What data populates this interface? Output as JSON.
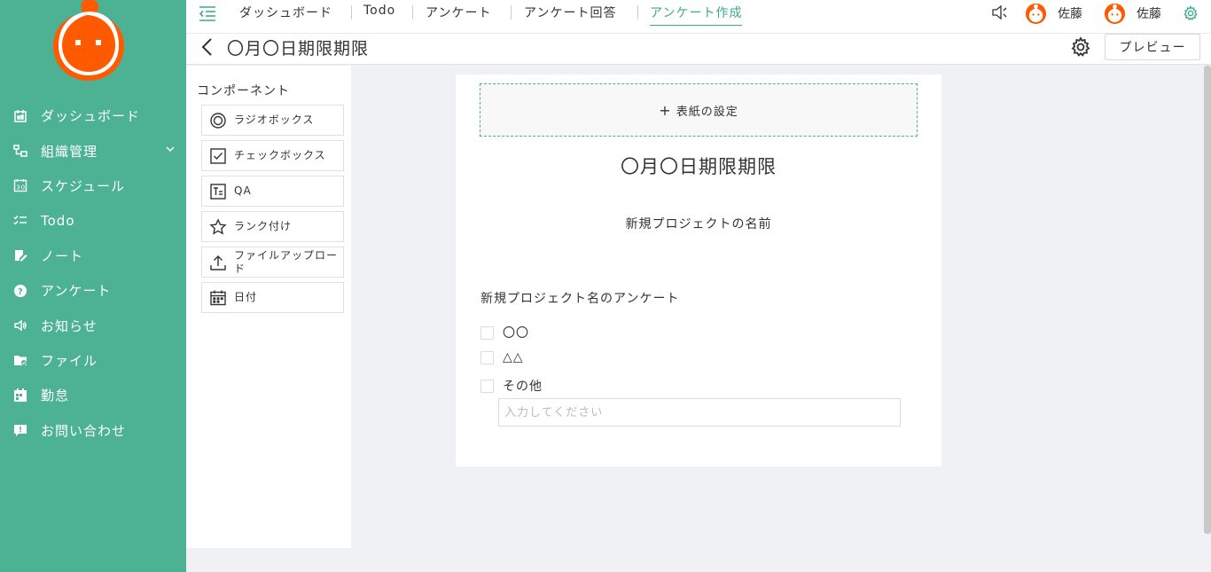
{
  "colors": {
    "brand": "#4cb293",
    "accent": "#3dab8a",
    "avatar_orange": "#ff5a00"
  },
  "sidebar": {
    "items": [
      {
        "label": "ダッシュボード",
        "icon": "dashboard-icon"
      },
      {
        "label": "組織管理",
        "icon": "org-icon",
        "expandable": true
      },
      {
        "label": "スケジュール",
        "icon": "calendar-icon"
      },
      {
        "label": "Todo",
        "icon": "todo-icon"
      },
      {
        "label": "ノート",
        "icon": "note-icon"
      },
      {
        "label": "アンケート",
        "icon": "survey-icon"
      },
      {
        "label": "お知らせ",
        "icon": "megaphone-icon"
      },
      {
        "label": "ファイル",
        "icon": "folder-icon"
      },
      {
        "label": "勤怠",
        "icon": "attendance-icon"
      },
      {
        "label": "お問い合わせ",
        "icon": "inquiry-icon"
      }
    ]
  },
  "topnav": {
    "tabs": [
      {
        "label": "ダッシュボード"
      },
      {
        "label": "Todo"
      },
      {
        "label": "アンケート"
      },
      {
        "label": "アンケート回答"
      },
      {
        "label": "アンケート作成",
        "active": true
      }
    ],
    "users": [
      {
        "name": "佐藤"
      },
      {
        "name": "佐藤"
      }
    ]
  },
  "subheader": {
    "title": "〇月〇日期限期限",
    "preview_label": "プレビュー"
  },
  "components": {
    "title": "コンポーネント",
    "items": [
      {
        "label": "ラジオボックス",
        "icon": "radio-icon"
      },
      {
        "label": "チェックボックス",
        "icon": "checkbox-icon"
      },
      {
        "label": "QA",
        "icon": "text-icon"
      },
      {
        "label": "ランク付け",
        "icon": "star-icon"
      },
      {
        "label": "ファイルアップロード",
        "icon": "upload-icon"
      },
      {
        "label": "日付",
        "icon": "date-icon"
      }
    ]
  },
  "form": {
    "cover_label": "表紙の設定",
    "title": "〇月〇日期限期限",
    "description": "新規プロジェクトの名前",
    "question": {
      "title": "新規プロジェクト名のアンケート",
      "options": [
        "〇〇",
        "△△",
        "その他"
      ],
      "other_placeholder": "入力してください"
    }
  }
}
